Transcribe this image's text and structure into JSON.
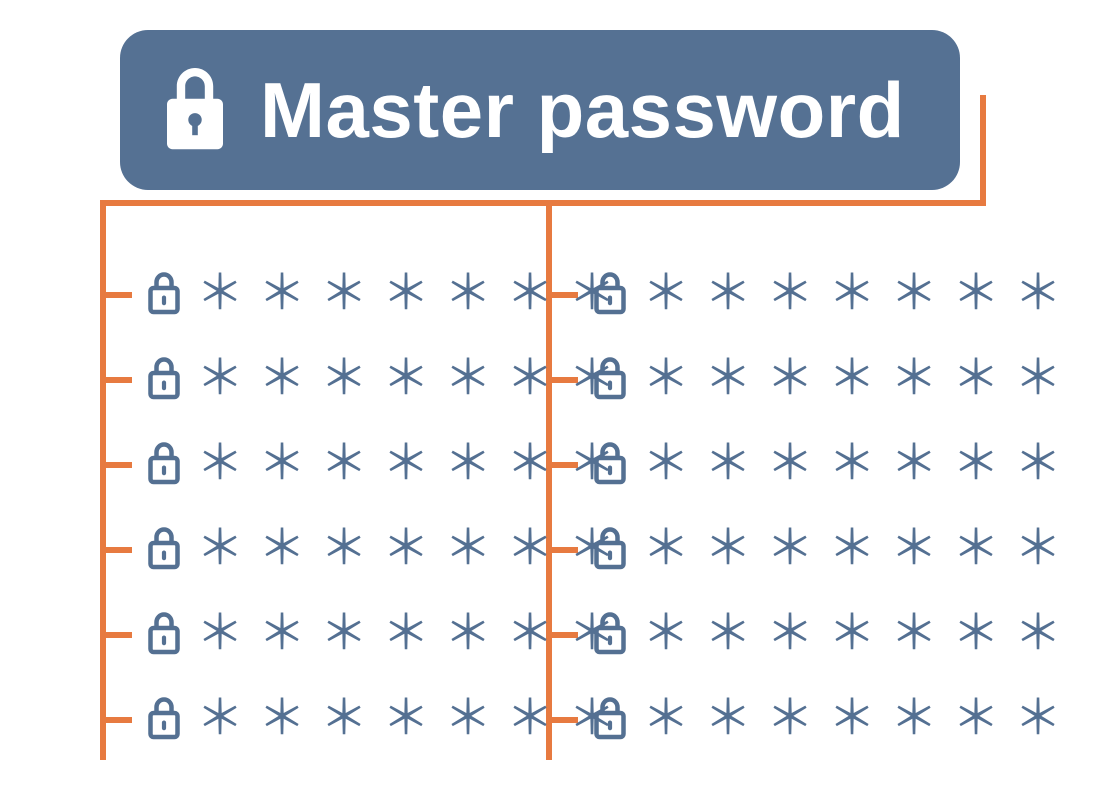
{
  "colors": {
    "box": "#557193",
    "connector": "#e77a40",
    "entry": "#547092",
    "master_text": "#ffffff"
  },
  "master": {
    "title": "Master password",
    "icon": "lock-icon"
  },
  "password_mask": "＊＊＊＊＊＊＊",
  "columns": {
    "left": [
      {
        "icon": "lock-icon",
        "mask_key": "password_mask"
      },
      {
        "icon": "lock-icon",
        "mask_key": "password_mask"
      },
      {
        "icon": "lock-icon",
        "mask_key": "password_mask"
      },
      {
        "icon": "lock-icon",
        "mask_key": "password_mask"
      },
      {
        "icon": "lock-icon",
        "mask_key": "password_mask"
      },
      {
        "icon": "lock-icon",
        "mask_key": "password_mask"
      }
    ],
    "right": [
      {
        "icon": "lock-icon",
        "mask_key": "password_mask"
      },
      {
        "icon": "lock-icon",
        "mask_key": "password_mask"
      },
      {
        "icon": "lock-icon",
        "mask_key": "password_mask"
      },
      {
        "icon": "lock-icon",
        "mask_key": "password_mask"
      },
      {
        "icon": "lock-icon",
        "mask_key": "password_mask"
      },
      {
        "icon": "lock-icon",
        "mask_key": "password_mask"
      }
    ]
  }
}
